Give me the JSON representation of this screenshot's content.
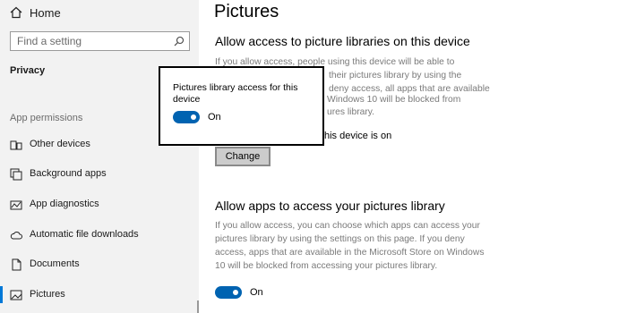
{
  "sidebar": {
    "home_label": "Home",
    "search_placeholder": "Find a setting",
    "section": "Privacy",
    "app_permissions_heading": "App permissions",
    "items": [
      {
        "label": "Other devices",
        "icon": "other-devices-icon"
      },
      {
        "label": "Background apps",
        "icon": "background-apps-icon"
      },
      {
        "label": "App diagnostics",
        "icon": "app-diagnostics-icon"
      },
      {
        "label": "Automatic file downloads",
        "icon": "cloud-icon"
      },
      {
        "label": "Documents",
        "icon": "document-icon"
      },
      {
        "label": "Pictures",
        "icon": "pictures-icon",
        "selected": true
      }
    ]
  },
  "main": {
    "title": "Pictures",
    "device_section": {
      "heading": "Allow access to picture libraries on this device",
      "lines": [
        "If you allow access, people using this device will be able to choose",
        "their pictures library by using the",
        "deny access, all apps that are available",
        "Windows 10 will be blocked from",
        "ures library."
      ],
      "status": "his device is on",
      "change_button": "Change"
    },
    "apps_section": {
      "heading": "Allow apps to access your pictures library",
      "description": "If you allow access, you can choose which apps can access your pictures library by using the settings on this page. If you deny access, apps that are available in the Microsoft Store on Windows 10 will be blocked from accessing your pictures library.",
      "toggle_label": "On",
      "toggle_on": true
    }
  },
  "popup": {
    "title": "Pictures library access for this device",
    "toggle_label": "On",
    "toggle_on": true
  },
  "colors": {
    "accent": "#0063b1",
    "selection": "#0078d7",
    "sidebar_bg": "#f2f2f2"
  }
}
